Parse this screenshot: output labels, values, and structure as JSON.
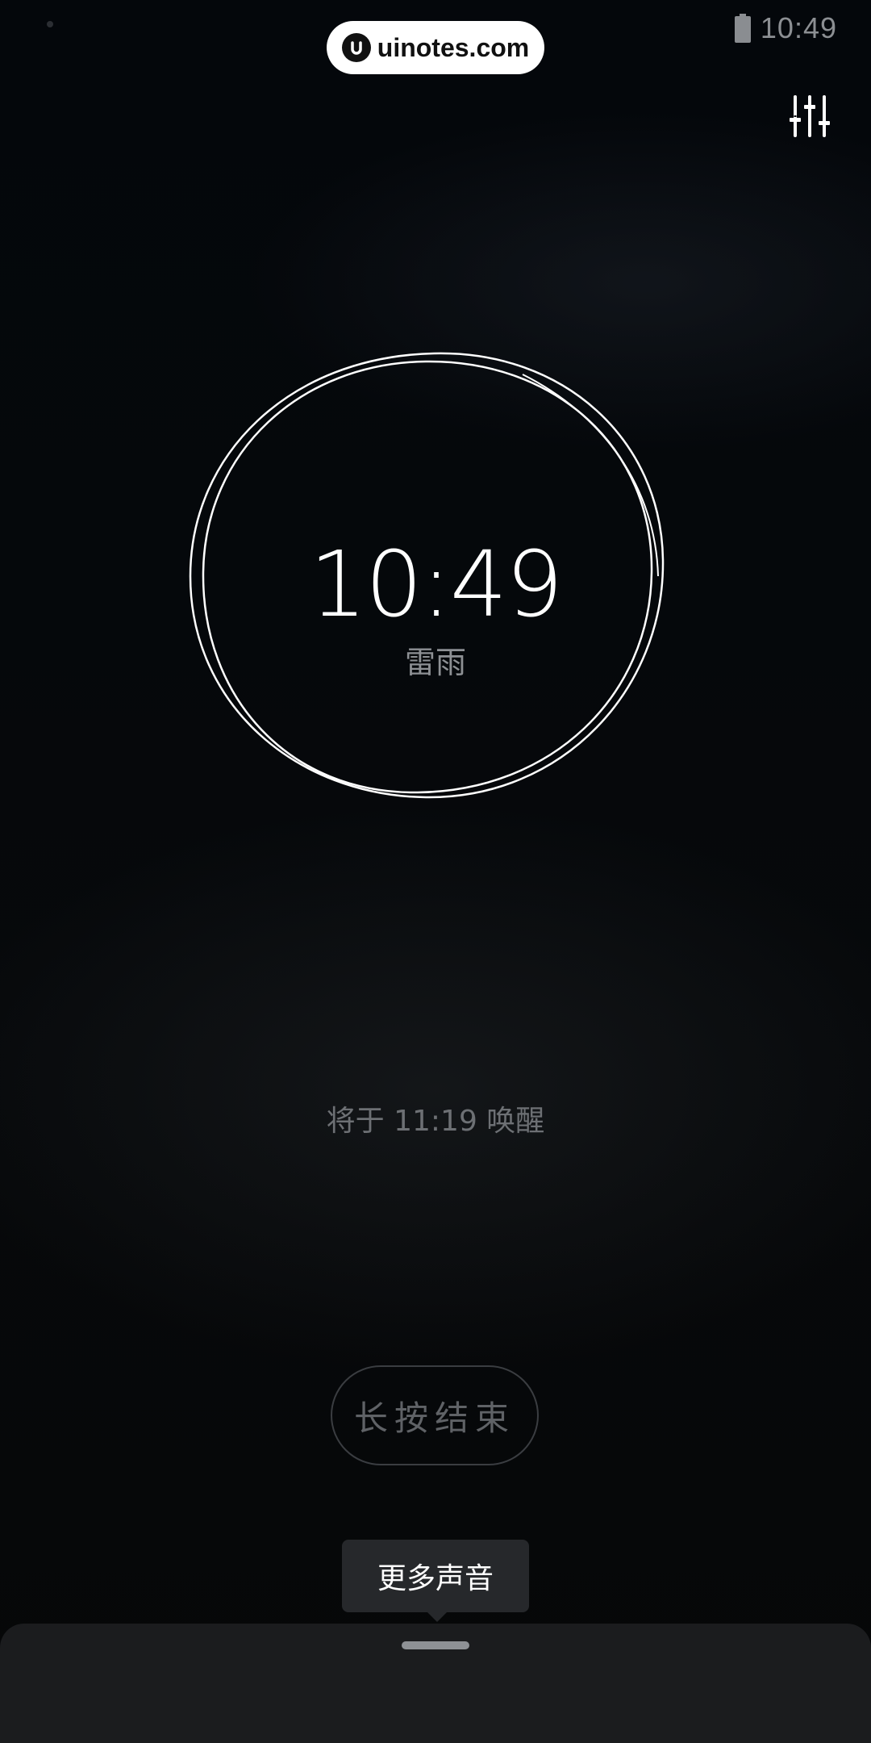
{
  "status_bar": {
    "time": "10:49",
    "battery_icon": "battery-icon"
  },
  "watermark": {
    "text": "uinotes.com",
    "logo_icon": "uinotes-logo-icon"
  },
  "toolbar": {
    "settings_icon": "sliders-icon"
  },
  "clock": {
    "time": "10:49",
    "sound_name": "雷雨"
  },
  "wake": {
    "text": "将于 11:19 唤醒"
  },
  "actions": {
    "end_label": "长按结束"
  },
  "tooltip": {
    "text": "更多声音"
  },
  "colors": {
    "background": "#05080b",
    "ring": "#ffffff",
    "sheet": "#1b1c1e"
  }
}
